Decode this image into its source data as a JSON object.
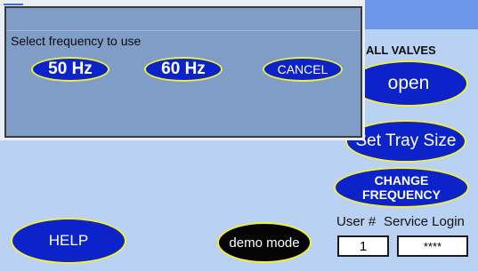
{
  "main": {
    "valves_heading": "ALL VALVES",
    "open_label": "open",
    "set_tray_label": "Set Tray Size",
    "change_frequency_label": "CHANGE\nFREQUENCY",
    "user_label": "User #",
    "service_login_label": "Service Login",
    "user_number_value": "1",
    "service_password_value": "****",
    "help_label": "HELP",
    "demo_mode_label": "demo mode"
  },
  "dialog": {
    "prompt": "Select frequency to use",
    "option_50": "50 Hz",
    "option_60": "60 Hz",
    "cancel_label": "CANCEL"
  },
  "colors": {
    "button_fill": "#0b23c8",
    "button_border": "#f2ee3c",
    "screen_bg": "#b9d1f3",
    "topbar": "#6d96e8",
    "dialog_bg": "#7f9dc6"
  }
}
